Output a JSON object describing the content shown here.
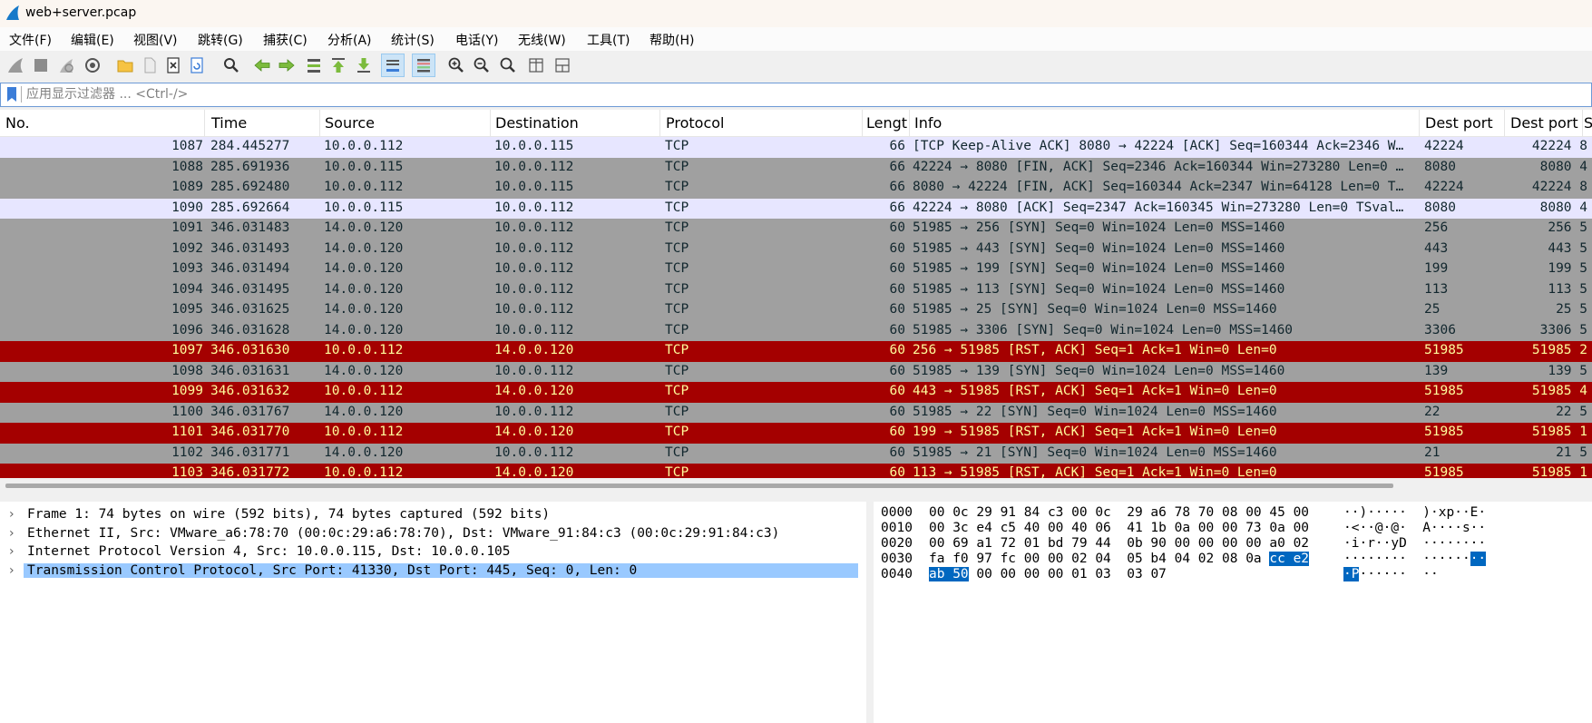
{
  "window": {
    "title": "web+server.pcap"
  },
  "menu": [
    "文件(F)",
    "编辑(E)",
    "视图(V)",
    "跳转(G)",
    "捕获(C)",
    "分析(A)",
    "统计(S)",
    "电话(Y)",
    "无线(W)",
    "工具(T)",
    "帮助(H)"
  ],
  "toolbar": {
    "icons": [
      "shark-fin-start-icon",
      "stop-icon",
      "restart-icon",
      "capture-options-icon",
      "open-folder-icon",
      "file-icon",
      "close-file-icon",
      "reload-icon",
      "find-icon",
      "back-arrow-icon",
      "forward-arrow-icon",
      "goto-packet-icon",
      "first-packet-icon",
      "last-packet-icon",
      "autoscroll-icon",
      "colorize-icon",
      "zoom-in-icon",
      "zoom-out-icon",
      "zoom-reset-icon",
      "resize-columns-icon",
      "layout-icon"
    ]
  },
  "filter": {
    "placeholder": "应用显示过滤器 ... <Ctrl-/>"
  },
  "columns": [
    "No.",
    "Time",
    "Source",
    "Destination",
    "Protocol",
    "Lengt",
    "Info",
    "Dest port",
    "Dest port",
    "S"
  ],
  "rows": [
    {
      "no": "1087",
      "time": "284.445277",
      "src": "10.0.0.112",
      "dst": "10.0.0.115",
      "proto": "TCP",
      "len": "66",
      "info": "[TCP Keep-Alive ACK] 8080 → 42224 [ACK] Seq=160344 Ack=2346 W…",
      "dp1": "42224",
      "dp2": "42224 8",
      "style": "light"
    },
    {
      "no": "1088",
      "time": "285.691936",
      "src": "10.0.0.115",
      "dst": "10.0.0.112",
      "proto": "TCP",
      "len": "66",
      "info": "42224 → 8080 [FIN, ACK] Seq=2346 Ack=160344 Win=273280 Len=0 …",
      "dp1": "8080",
      "dp2": "8080 4",
      "style": "gray"
    },
    {
      "no": "1089",
      "time": "285.692480",
      "src": "10.0.0.112",
      "dst": "10.0.0.115",
      "proto": "TCP",
      "len": "66",
      "info": "8080 → 42224 [FIN, ACK] Seq=160344 Ack=2347 Win=64128 Len=0 T…",
      "dp1": "42224",
      "dp2": "42224 8",
      "style": "gray"
    },
    {
      "no": "1090",
      "time": "285.692664",
      "src": "10.0.0.115",
      "dst": "10.0.0.112",
      "proto": "TCP",
      "len": "66",
      "info": "42224 → 8080 [ACK] Seq=2347 Ack=160345 Win=273280 Len=0 TSval…",
      "dp1": "8080",
      "dp2": "8080 4",
      "style": "light"
    },
    {
      "no": "1091",
      "time": "346.031483",
      "src": "14.0.0.120",
      "dst": "10.0.0.112",
      "proto": "TCP",
      "len": "60",
      "info": "51985 → 256 [SYN] Seq=0 Win=1024 Len=0 MSS=1460",
      "dp1": "256",
      "dp2": "256 5",
      "style": "gray"
    },
    {
      "no": "1092",
      "time": "346.031493",
      "src": "14.0.0.120",
      "dst": "10.0.0.112",
      "proto": "TCP",
      "len": "60",
      "info": "51985 → 443 [SYN] Seq=0 Win=1024 Len=0 MSS=1460",
      "dp1": "443",
      "dp2": "443 5",
      "style": "gray"
    },
    {
      "no": "1093",
      "time": "346.031494",
      "src": "14.0.0.120",
      "dst": "10.0.0.112",
      "proto": "TCP",
      "len": "60",
      "info": "51985 → 199 [SYN] Seq=0 Win=1024 Len=0 MSS=1460",
      "dp1": "199",
      "dp2": "199 5",
      "style": "gray"
    },
    {
      "no": "1094",
      "time": "346.031495",
      "src": "14.0.0.120",
      "dst": "10.0.0.112",
      "proto": "TCP",
      "len": "60",
      "info": "51985 → 113 [SYN] Seq=0 Win=1024 Len=0 MSS=1460",
      "dp1": "113",
      "dp2": "113 5",
      "style": "gray"
    },
    {
      "no": "1095",
      "time": "346.031625",
      "src": "14.0.0.120",
      "dst": "10.0.0.112",
      "proto": "TCP",
      "len": "60",
      "info": "51985 → 25 [SYN] Seq=0 Win=1024 Len=0 MSS=1460",
      "dp1": "25",
      "dp2": "25 5",
      "style": "gray"
    },
    {
      "no": "1096",
      "time": "346.031628",
      "src": "14.0.0.120",
      "dst": "10.0.0.112",
      "proto": "TCP",
      "len": "60",
      "info": "51985 → 3306 [SYN] Seq=0 Win=1024 Len=0 MSS=1460",
      "dp1": "3306",
      "dp2": "3306 5",
      "style": "gray"
    },
    {
      "no": "1097",
      "time": "346.031630",
      "src": "10.0.0.112",
      "dst": "14.0.0.120",
      "proto": "TCP",
      "len": "60",
      "info": "256 → 51985 [RST, ACK] Seq=1 Ack=1 Win=0 Len=0",
      "dp1": "51985",
      "dp2": "51985 2",
      "style": "red"
    },
    {
      "no": "1098",
      "time": "346.031631",
      "src": "14.0.0.120",
      "dst": "10.0.0.112",
      "proto": "TCP",
      "len": "60",
      "info": "51985 → 139 [SYN] Seq=0 Win=1024 Len=0 MSS=1460",
      "dp1": "139",
      "dp2": "139 5",
      "style": "gray"
    },
    {
      "no": "1099",
      "time": "346.031632",
      "src": "10.0.0.112",
      "dst": "14.0.0.120",
      "proto": "TCP",
      "len": "60",
      "info": "443 → 51985 [RST, ACK] Seq=1 Ack=1 Win=0 Len=0",
      "dp1": "51985",
      "dp2": "51985 4",
      "style": "red"
    },
    {
      "no": "1100",
      "time": "346.031767",
      "src": "14.0.0.120",
      "dst": "10.0.0.112",
      "proto": "TCP",
      "len": "60",
      "info": "51985 → 22 [SYN] Seq=0 Win=1024 Len=0 MSS=1460",
      "dp1": "22",
      "dp2": "22 5",
      "style": "gray"
    },
    {
      "no": "1101",
      "time": "346.031770",
      "src": "10.0.0.112",
      "dst": "14.0.0.120",
      "proto": "TCP",
      "len": "60",
      "info": "199 → 51985 [RST, ACK] Seq=1 Ack=1 Win=0 Len=0",
      "dp1": "51985",
      "dp2": "51985 1",
      "style": "red"
    },
    {
      "no": "1102",
      "time": "346.031771",
      "src": "14.0.0.120",
      "dst": "10.0.0.112",
      "proto": "TCP",
      "len": "60",
      "info": "51985 → 21 [SYN] Seq=0 Win=1024 Len=0 MSS=1460",
      "dp1": "21",
      "dp2": "21 5",
      "style": "gray"
    },
    {
      "no": "1103",
      "time": "346.031772",
      "src": "10.0.0.112",
      "dst": "14.0.0.120",
      "proto": "TCP",
      "len": "60",
      "info": "113 → 51985 [RST, ACK] Seq=1 Ack=1 Win=0 Len=0",
      "dp1": "51985",
      "dp2": "51985 1",
      "style": "red"
    }
  ],
  "details": [
    {
      "text": "Frame 1: 74 bytes on wire (592 bits), 74 bytes captured (592 bits)",
      "selected": false
    },
    {
      "text": "Ethernet II, Src: VMware_a6:78:70 (00:0c:29:a6:78:70), Dst: VMware_91:84:c3 (00:0c:29:91:84:c3)",
      "selected": false
    },
    {
      "text": "Internet Protocol Version 4, Src: 10.0.0.115, Dst: 10.0.0.105",
      "selected": false
    },
    {
      "text": "Transmission Control Protocol, Src Port: 41330, Dst Port: 445, Seq: 0, Len: 0",
      "selected": true
    }
  ],
  "bytes": [
    {
      "offset": "0000",
      "hex_pre": "00 0c 29 91 84 c3 00 0c  29 a6 78 70 08 00 45 00",
      "hex_hl": "",
      "hex_post": "",
      "asc_pre": "··)·····  )·xp··E·",
      "asc_hl": "",
      "asc_post": ""
    },
    {
      "offset": "0010",
      "hex_pre": "00 3c e4 c5 40 00 40 06  41 1b 0a 00 00 73 0a 00",
      "hex_hl": "",
      "hex_post": "",
      "asc_pre": "·<··@·@·  A····s··",
      "asc_hl": "",
      "asc_post": ""
    },
    {
      "offset": "0020",
      "hex_pre": "00 69 a1 72 01 bd 79 44  0b 90 00 00 00 00 a0 02",
      "hex_hl": "",
      "hex_post": "",
      "asc_pre": "·i·r··yD  ········",
      "asc_hl": "",
      "asc_post": ""
    },
    {
      "offset": "0030",
      "hex_pre": "fa f0 97 fc 00 00 02 04  05 b4 04 02 08 0a ",
      "hex_hl": "cc e2",
      "hex_post": "",
      "asc_pre": "········  ······",
      "asc_hl": "··",
      "asc_post": ""
    },
    {
      "offset": "0040",
      "hex_pre": "",
      "hex_hl": "ab 50",
      "hex_post": " 00 00 00 00 01 03  03 07",
      "asc_pre": "",
      "asc_hl": "·P",
      "asc_post": "······  ··"
    }
  ]
}
